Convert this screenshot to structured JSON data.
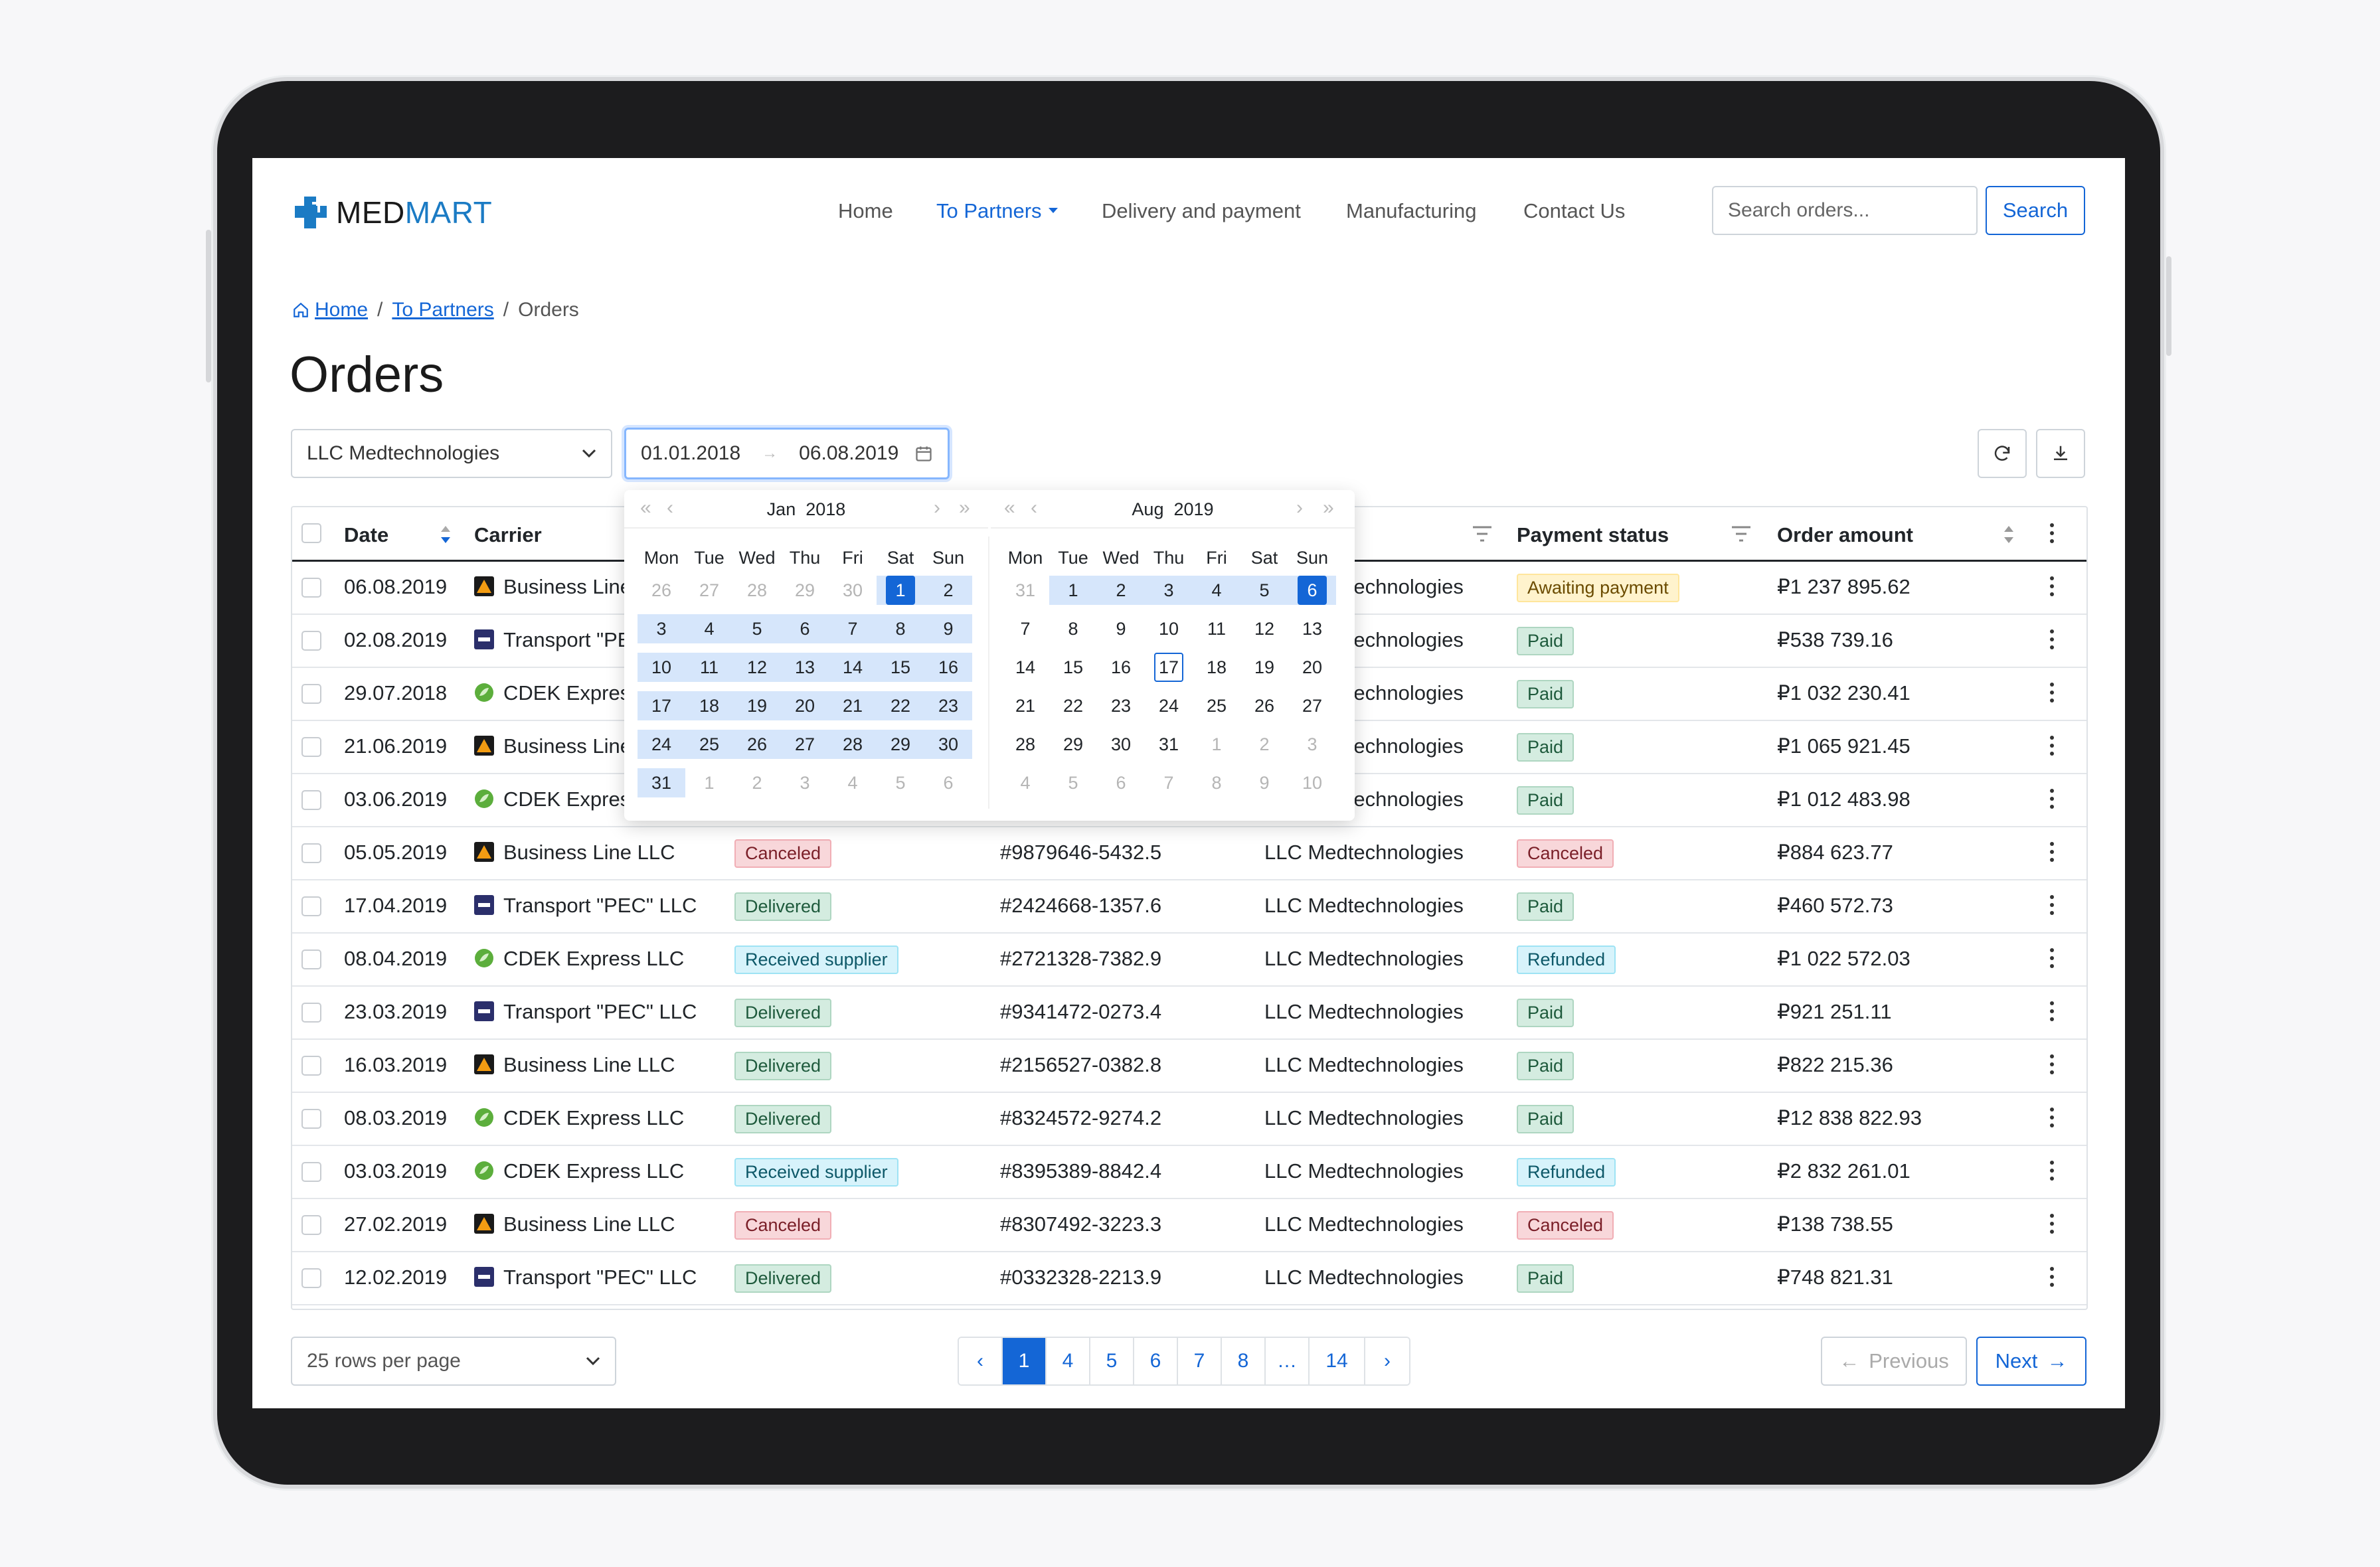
{
  "brand": {
    "part1": "MED",
    "part2": "MART"
  },
  "nav": {
    "home": "Home",
    "partners": "To Partners",
    "delivery": "Delivery and payment",
    "manufacturing": "Manufacturing",
    "contact": "Contact Us",
    "search_placeholder": "Search orders...",
    "search_label": "Search"
  },
  "breadcrumb": {
    "home": "Home",
    "partners": "To Partners",
    "current": "Orders",
    "sep": "/"
  },
  "page_title": "Orders",
  "filters": {
    "company": "LLC Medtechnologies",
    "date_from": "01.01.2018",
    "date_to": "06.08.2019"
  },
  "columns": {
    "date": "Date",
    "carrier": "Carrier",
    "payment_status": "Payment status",
    "order_amount": "Order amount"
  },
  "datepicker": {
    "left": {
      "month": "Jan",
      "year": "2018"
    },
    "right": {
      "month": "Aug",
      "year": "2019"
    },
    "weekdays": [
      "Mon",
      "Tue",
      "Wed",
      "Thu",
      "Fri",
      "Sat",
      "Sun"
    ]
  },
  "rows": [
    {
      "date": "06.08.2019",
      "carrier": "Business Line LLC",
      "carrier_icon": "business-line",
      "status": "",
      "status_kind": "",
      "order": "",
      "partner": "LLC Medtechnologies",
      "payment": "Awaiting payment",
      "payment_kind": "yellow",
      "amount": "₽1 237 895.62"
    },
    {
      "date": "02.08.2019",
      "carrier": "Transport \"PEC\" LLC",
      "carrier_icon": "pec",
      "status": "",
      "status_kind": "",
      "order": "",
      "partner": "LLC Medtechnologies",
      "payment": "Paid",
      "payment_kind": "green",
      "amount": "₽538 739.16"
    },
    {
      "date": "29.07.2018",
      "carrier": "CDEK Express LLC",
      "carrier_icon": "cdek",
      "status": "",
      "status_kind": "",
      "order": "",
      "partner": "LLC Medtechnologies",
      "payment": "Paid",
      "payment_kind": "green",
      "amount": "₽1 032 230.41"
    },
    {
      "date": "21.06.2019",
      "carrier": "Business Line LLC",
      "carrier_icon": "business-line",
      "status": "",
      "status_kind": "",
      "order": "",
      "partner": "LLC Medtechnologies",
      "payment": "Paid",
      "payment_kind": "green",
      "amount": "₽1 065 921.45"
    },
    {
      "date": "03.06.2019",
      "carrier": "CDEK Express LLC",
      "carrier_icon": "cdek",
      "status": "",
      "status_kind": "",
      "order": "",
      "partner": "LLC Medtechnologies",
      "payment": "Paid",
      "payment_kind": "green",
      "amount": "₽1 012 483.98"
    },
    {
      "date": "05.05.2019",
      "carrier": "Business Line LLC",
      "carrier_icon": "business-line",
      "status": "Canceled",
      "status_kind": "red",
      "order": "#9879646-5432.5",
      "partner": "LLC Medtechnologies",
      "payment": "Canceled",
      "payment_kind": "red",
      "amount": "₽884 623.77"
    },
    {
      "date": "17.04.2019",
      "carrier": "Transport \"PEC\" LLC",
      "carrier_icon": "pec",
      "status": "Delivered",
      "status_kind": "green",
      "order": "#2424668-1357.6",
      "partner": "LLC Medtechnologies",
      "payment": "Paid",
      "payment_kind": "green",
      "amount": "₽460 572.73"
    },
    {
      "date": "08.04.2019",
      "carrier": "CDEK Express LLC",
      "carrier_icon": "cdek",
      "status": "Received supplier",
      "status_kind": "cyan",
      "order": "#2721328-7382.9",
      "partner": "LLC Medtechnologies",
      "payment": "Refunded",
      "payment_kind": "cyan",
      "amount": "₽1 022 572.03"
    },
    {
      "date": "23.03.2019",
      "carrier": "Transport \"PEC\" LLC",
      "carrier_icon": "pec",
      "status": "Delivered",
      "status_kind": "green",
      "order": "#9341472-0273.4",
      "partner": "LLC Medtechnologies",
      "payment": "Paid",
      "payment_kind": "green",
      "amount": "₽921 251.11"
    },
    {
      "date": "16.03.2019",
      "carrier": "Business Line LLC",
      "carrier_icon": "business-line",
      "status": "Delivered",
      "status_kind": "green",
      "order": "#2156527-0382.8",
      "partner": "LLC Medtechnologies",
      "payment": "Paid",
      "payment_kind": "green",
      "amount": "₽822 215.36"
    },
    {
      "date": "08.03.2019",
      "carrier": "CDEK Express LLC",
      "carrier_icon": "cdek",
      "status": "Delivered",
      "status_kind": "green",
      "order": "#8324572-9274.2",
      "partner": "LLC Medtechnologies",
      "payment": "Paid",
      "payment_kind": "green",
      "amount": "₽12 838 822.93"
    },
    {
      "date": "03.03.2019",
      "carrier": "CDEK Express LLC",
      "carrier_icon": "cdek",
      "status": "Received supplier",
      "status_kind": "cyan",
      "order": "#8395389-8842.4",
      "partner": "LLC Medtechnologies",
      "payment": "Refunded",
      "payment_kind": "cyan",
      "amount": "₽2 832 261.01"
    },
    {
      "date": "27.02.2019",
      "carrier": "Business Line LLC",
      "carrier_icon": "business-line",
      "status": "Canceled",
      "status_kind": "red",
      "order": "#8307492-3223.3",
      "partner": "LLC Medtechnologies",
      "payment": "Canceled",
      "payment_kind": "red",
      "amount": "₽138 738.55"
    },
    {
      "date": "12.02.2019",
      "carrier": "Transport \"PEC\" LLC",
      "carrier_icon": "pec",
      "status": "Delivered",
      "status_kind": "green",
      "order": "#0332328-2213.9",
      "partner": "LLC Medtechnologies",
      "payment": "Paid",
      "payment_kind": "green",
      "amount": "₽748 821.31"
    }
  ],
  "footer": {
    "rows_per_page": "25 rows per page",
    "pages": [
      "1",
      "4",
      "5",
      "6",
      "7",
      "8",
      "…",
      "14"
    ],
    "active_page": "1",
    "previous": "Previous",
    "next": "Next"
  },
  "colors": {
    "primary": "#1466d6",
    "brand_blue": "#1b7bc4"
  }
}
